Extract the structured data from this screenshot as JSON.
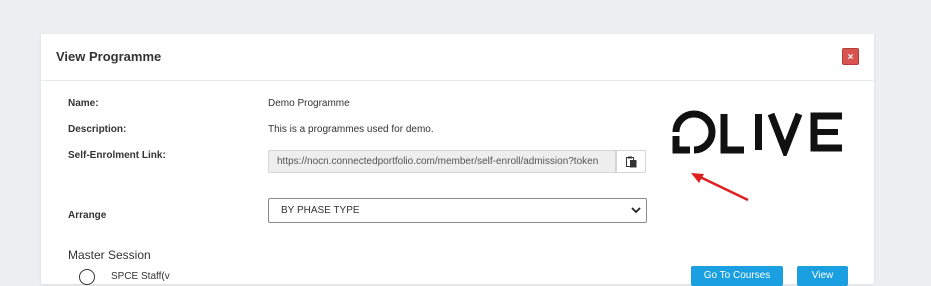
{
  "modal": {
    "title": "View Programme",
    "close_label": "×"
  },
  "fields": {
    "name_label": "Name:",
    "name_value": "Demo Programme",
    "description_label": "Description:",
    "description_value": "This is a programmes used for demo.",
    "enrol_label": "Self-Enrolment Link:",
    "enrol_value": "https://nocn.connectedportfolio.com/member/self-enroll/admission?token",
    "arrange_label": "Arrange",
    "arrange_value": "BY PHASE TYPE"
  },
  "logo": {
    "text": "OLIVE"
  },
  "master_session": {
    "title": "Master Session",
    "radio_label": "SPCE Staff(v"
  },
  "buttons": {
    "go_to_courses": "Go To Courses",
    "view": "View"
  },
  "colors": {
    "close_red": "#d9534f",
    "button_blue": "#1a9fe0",
    "annotation_arrow": "#e02020"
  },
  "icons": {
    "copy": "clipboard-icon",
    "dropdown": "chevron-down-icon"
  }
}
